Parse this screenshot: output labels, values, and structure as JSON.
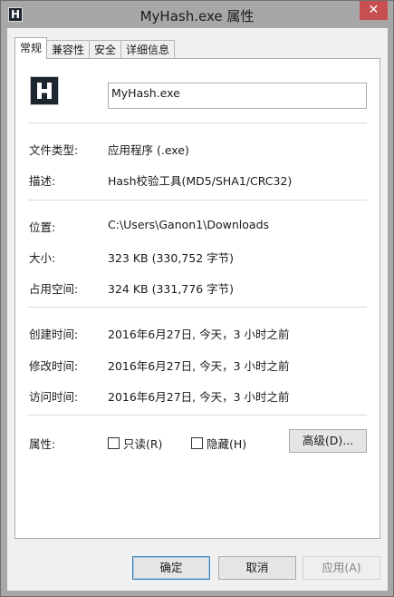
{
  "window": {
    "title": "MyHash.exe 属性",
    "app_icon_letter": "H",
    "close_glyph": "✕"
  },
  "tabs": [
    {
      "label": "常规",
      "active": true
    },
    {
      "label": "兼容性",
      "active": false
    },
    {
      "label": "安全",
      "active": false
    },
    {
      "label": "详细信息",
      "active": false
    }
  ],
  "general": {
    "file_name": "MyHash.exe",
    "file_type_label": "文件类型:",
    "file_type_value": "应用程序 (.exe)",
    "description_label": "描述:",
    "description_value": "Hash校验工具(MD5/SHA1/CRC32)",
    "location_label": "位置:",
    "location_value": "C:\\Users\\Ganon1\\Downloads",
    "size_label": "大小:",
    "size_value": "323 KB (330,752 字节)",
    "size_on_disk_label": "占用空间:",
    "size_on_disk_value": "324 KB (331,776 字节)",
    "created_label": "创建时间:",
    "created_value": "2016年6月27日, 今天，3 小时之前",
    "modified_label": "修改时间:",
    "modified_value": "2016年6月27日, 今天，3 小时之前",
    "accessed_label": "访问时间:",
    "accessed_value": "2016年6月27日, 今天，3 小时之前",
    "attributes_label": "属性:",
    "readonly_label": "只读(R)",
    "readonly_checked": false,
    "hidden_label": "隐藏(H)",
    "hidden_checked": false,
    "advanced_button": "高级(D)..."
  },
  "footer": {
    "ok": "确定",
    "cancel": "取消",
    "apply": "应用(A)"
  },
  "colors": {
    "titlebar": "#a7a7a7",
    "close_button": "#c74f4f",
    "dialog_bg": "#f0f0f0",
    "default_button_border": "#3c7fb1"
  }
}
